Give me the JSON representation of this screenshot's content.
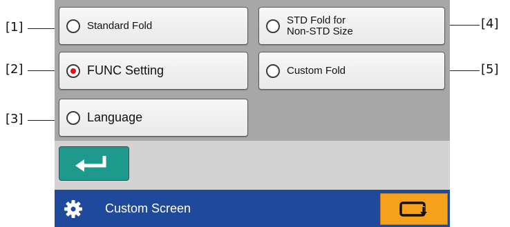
{
  "options": {
    "standard_fold": {
      "label": "Standard Fold",
      "selected": false
    },
    "std_fold_non_std": {
      "line1": "STD Fold for",
      "line2": "Non-STD Size",
      "selected": false
    },
    "func_setting": {
      "label": "FUNC Setting",
      "selected": true
    },
    "custom_fold": {
      "label": "Custom Fold",
      "selected": false
    },
    "language": {
      "label": "Language",
      "selected": false
    }
  },
  "return_button": {
    "icon": "return-arrow-icon"
  },
  "footer": {
    "title": "Custom Screen",
    "settings_icon": "gear-icon",
    "switch_icon": "screen-switch-icon"
  },
  "callouts": {
    "c1": "[1]",
    "c2": "[2]",
    "c3": "[3]",
    "c4": "[4]",
    "c5": "[5]"
  },
  "colors": {
    "panel": "#a7a7a7",
    "band": "#d3d3d3",
    "footer": "#1f4a9c",
    "return_button": "#1d9a8c",
    "switch_button": "#f5a11c",
    "selected_radio": "#e0101a"
  }
}
